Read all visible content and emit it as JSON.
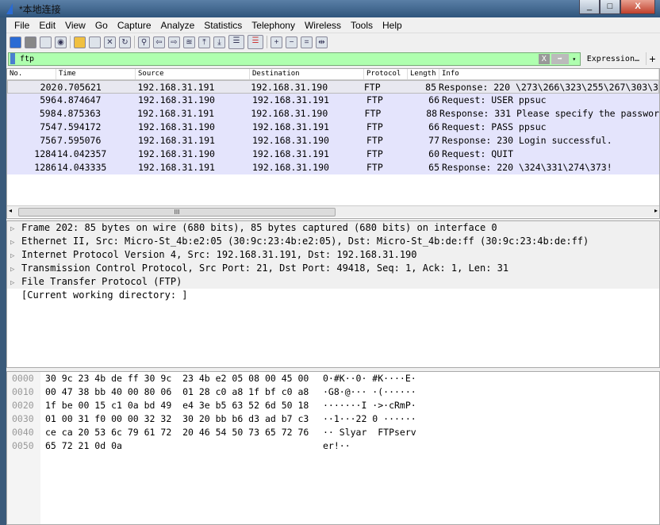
{
  "window": {
    "title": "*本地连接",
    "buttons": [
      "_",
      "□",
      "X"
    ]
  },
  "menu": [
    "File",
    "Edit",
    "View",
    "Go",
    "Capture",
    "Analyze",
    "Statistics",
    "Telephony",
    "Wireless",
    "Tools",
    "Help"
  ],
  "filter": {
    "value": "ftp",
    "clear": "X",
    "apply": "➡",
    "dropdown": "▾",
    "expression": "Expression…",
    "add": "+"
  },
  "columns": [
    "No.",
    "Time",
    "Source",
    "Destination",
    "Protocol",
    "Length",
    "Info"
  ],
  "packets": [
    {
      "no": "202",
      "time": "0.705621",
      "src": "192.168.31.191",
      "dst": "192.168.31.190",
      "proto": "FTP",
      "len": "85",
      "info": "Response: 220 \\273\\266\\323\\255\\267\\303\\3"
    },
    {
      "no": "596",
      "time": "4.874647",
      "src": "192.168.31.190",
      "dst": "192.168.31.191",
      "proto": "FTP",
      "len": "66",
      "info": "Request: USER ppsuc"
    },
    {
      "no": "598",
      "time": "4.875363",
      "src": "192.168.31.191",
      "dst": "192.168.31.190",
      "proto": "FTP",
      "len": "88",
      "info": "Response: 331 Please specify the passwor"
    },
    {
      "no": "754",
      "time": "7.594172",
      "src": "192.168.31.190",
      "dst": "192.168.31.191",
      "proto": "FTP",
      "len": "66",
      "info": "Request: PASS ppsuc"
    },
    {
      "no": "756",
      "time": "7.595076",
      "src": "192.168.31.191",
      "dst": "192.168.31.190",
      "proto": "FTP",
      "len": "77",
      "info": "Response: 230 Login successful."
    },
    {
      "no": "1284",
      "time": "14.042357",
      "src": "192.168.31.190",
      "dst": "192.168.31.191",
      "proto": "FTP",
      "len": "60",
      "info": "Request: QUIT"
    },
    {
      "no": "1286",
      "time": "14.043335",
      "src": "192.168.31.191",
      "dst": "192.168.31.190",
      "proto": "FTP",
      "len": "65",
      "info": "Response: 220 \\324\\331\\274\\373!"
    }
  ],
  "details": [
    "Frame 202: 85 bytes on wire (680 bits), 85 bytes captured (680 bits) on interface 0",
    "Ethernet II, Src: Micro-St_4b:e2:05 (30:9c:23:4b:e2:05), Dst: Micro-St_4b:de:ff (30:9c:23:4b:de:ff)",
    "Internet Protocol Version 4, Src: 192.168.31.191, Dst: 192.168.31.190",
    "Transmission Control Protocol, Src Port: 21, Dst Port: 49418, Seq: 1, Ack: 1, Len: 31",
    "File Transfer Protocol (FTP)"
  ],
  "detail_extra": "[Current working directory: ]",
  "hex": [
    {
      "off": "0000",
      "bytes": "30 9c 23 4b de ff 30 9c  23 4b e2 05 08 00 45 00",
      "ascii": "0·#K··0· #K····E·"
    },
    {
      "off": "0010",
      "bytes": "00 47 38 bb 40 00 80 06  01 28 c0 a8 1f bf c0 a8",
      "ascii": "·G8·@··· ·(······"
    },
    {
      "off": "0020",
      "bytes": "1f be 00 15 c1 0a bd 49  e4 3e b5 63 52 6d 50 18",
      "ascii": "·······I ·>·cRmP·"
    },
    {
      "off": "0030",
      "bytes": "01 00 31 f0 00 00 32 32  30 20 bb b6 d3 ad b7 c3",
      "ascii": "··1···22 0 ······"
    },
    {
      "off": "0040",
      "bytes": "ce ca 20 53 6c 79 61 72  20 46 54 50 73 65 72 76",
      "ascii": "·· Slyar  FTPserv"
    },
    {
      "off": "0050",
      "bytes": "65 72 21 0d 0a",
      "ascii": "er!··"
    }
  ],
  "scroll_grip": "III"
}
